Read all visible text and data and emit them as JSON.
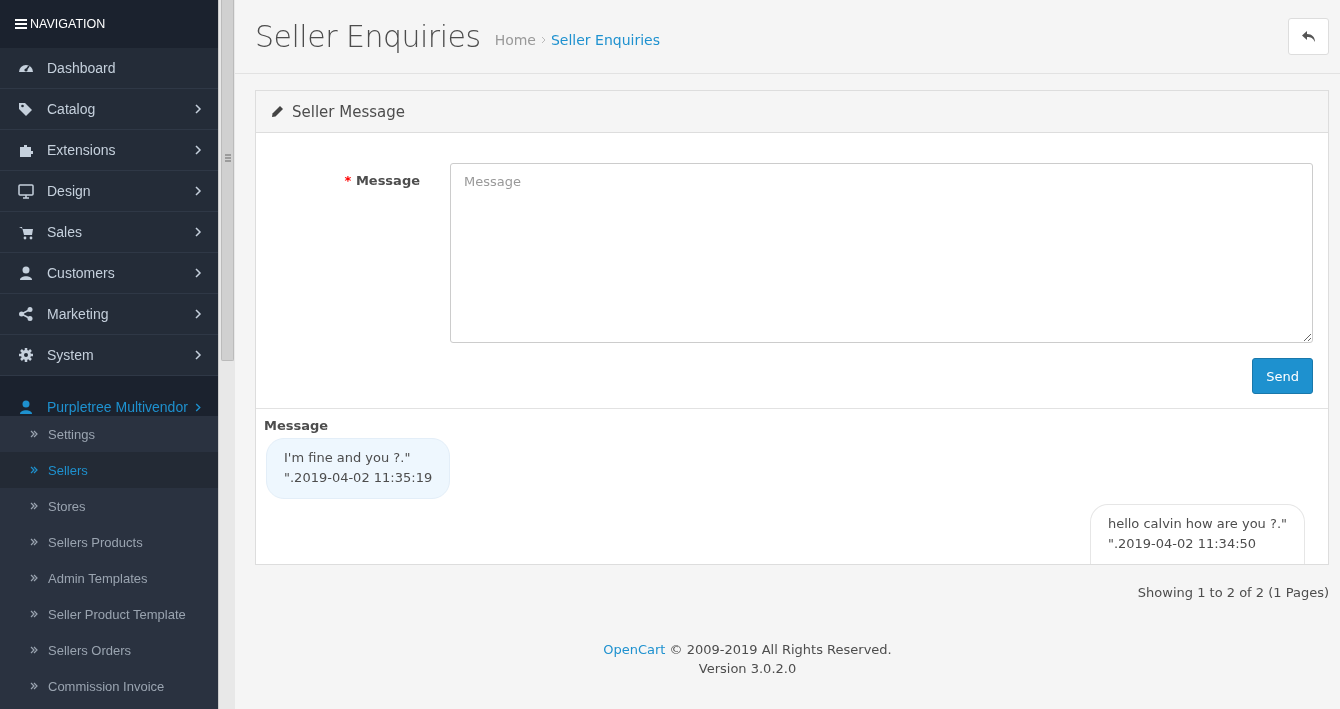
{
  "navigation": {
    "title": "NAVIGATION",
    "items": [
      {
        "label": "Dashboard",
        "has_children": false,
        "selected": false
      },
      {
        "label": "Catalog",
        "has_children": true,
        "selected": false
      },
      {
        "label": "Extensions",
        "has_children": true,
        "selected": false
      },
      {
        "label": "Design",
        "has_children": true,
        "selected": false
      },
      {
        "label": "Sales",
        "has_children": true,
        "selected": false
      },
      {
        "label": "Customers",
        "has_children": true,
        "selected": false
      },
      {
        "label": "Marketing",
        "has_children": true,
        "selected": false
      },
      {
        "label": "System",
        "has_children": true,
        "selected": false
      },
      {
        "label": "Purpletree Multivendor",
        "has_children": true,
        "selected": true,
        "children": [
          {
            "label": "Settings",
            "selected": false
          },
          {
            "label": "Sellers",
            "selected": true
          },
          {
            "label": "Stores",
            "selected": false
          },
          {
            "label": "Sellers Products",
            "selected": false
          },
          {
            "label": "Admin Templates",
            "selected": false
          },
          {
            "label": "Seller Product Template",
            "selected": false
          },
          {
            "label": "Sellers Orders",
            "selected": false
          },
          {
            "label": "Commission Invoice",
            "selected": false
          }
        ]
      }
    ]
  },
  "header": {
    "title": "Seller Enquiries",
    "breadcrumb": [
      "Home",
      "Seller Enquiries"
    ]
  },
  "panel": {
    "title": "Seller Message",
    "form": {
      "label": "Message",
      "required_mark": "*",
      "placeholder": "Message",
      "button": "Send"
    },
    "messages_heading": "Message",
    "messages": [
      {
        "kind": "received",
        "text": "I'm fine and you ?.\"",
        "time": "\".2019-04-02 11:35:19"
      },
      {
        "kind": "sent",
        "text": "hello calvin how are you ?.\"",
        "time": "\".2019-04-02 11:34:50"
      }
    ]
  },
  "pagination": "Showing 1 to 2 of 2 (1 Pages)",
  "footer": {
    "link": "OpenCart",
    "text": " © 2009-2019 All Rights Reserved.",
    "version": "Version 3.0.2.0"
  }
}
